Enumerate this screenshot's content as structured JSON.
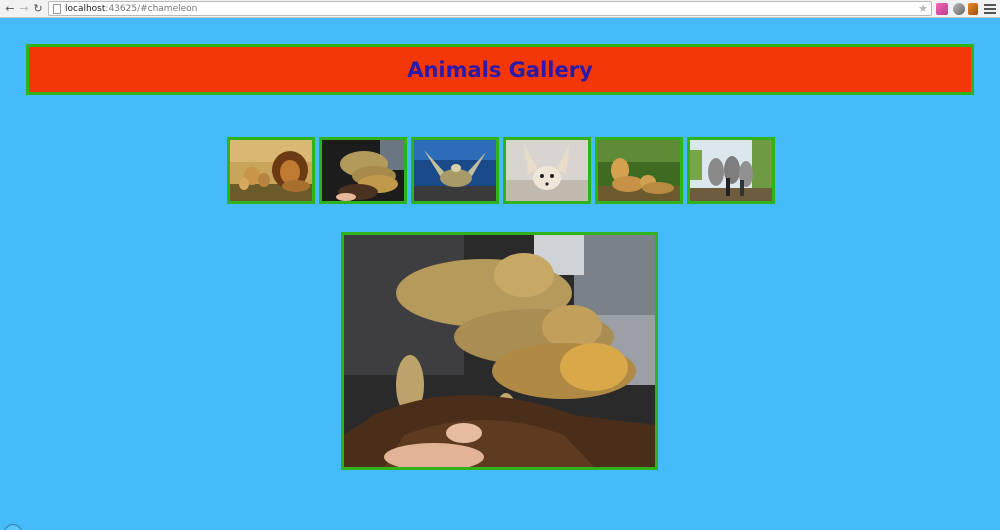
{
  "browser": {
    "url_host": "localhost",
    "url_rest": ":43625/#chameleon",
    "back_icon": "←",
    "forward_icon": "→",
    "reload_icon": "↻",
    "star_icon": "★"
  },
  "header": {
    "title": "Animals Gallery"
  },
  "gallery": {
    "thumbnails": [
      "lion",
      "bearded-dragons",
      "sea-turtle",
      "fennec-fox",
      "cheetahs",
      "lemurs"
    ],
    "selected": "chameleon"
  },
  "colors": {
    "background": "#45bcf9",
    "header_bg": "#f33707",
    "header_text": "#2d1aa8",
    "border": "#30b21c"
  }
}
